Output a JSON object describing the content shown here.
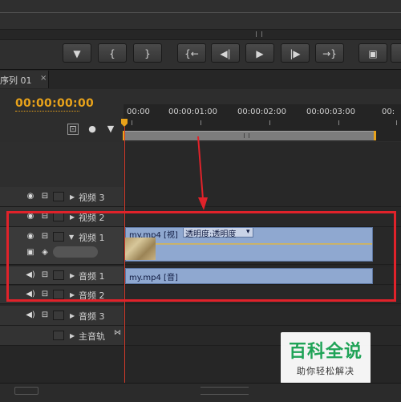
{
  "transport": {
    "buttons": [
      {
        "name": "marker-button",
        "glyph": "▼"
      },
      {
        "name": "mark-in-button",
        "glyph": "{"
      },
      {
        "name": "mark-out-button",
        "glyph": "}"
      },
      {
        "name": "go-to-in-button",
        "glyph": "{←"
      },
      {
        "name": "step-back-button",
        "glyph": "◀|"
      },
      {
        "name": "play-button",
        "glyph": "▶"
      },
      {
        "name": "step-forward-button",
        "glyph": "|▶"
      },
      {
        "name": "go-to-out-button",
        "glyph": "→}"
      },
      {
        "name": "lift-button",
        "glyph": "▣"
      }
    ]
  },
  "tab": {
    "label": "序列 01",
    "close": "×"
  },
  "header": {
    "timecode": "00:00:00:00"
  },
  "ruler": {
    "labels": [
      "00:00",
      "00:00:01:00",
      "00:00:02:00",
      "00:00:03:00",
      "00:"
    ]
  },
  "tracks": [
    {
      "name": "视频 3",
      "kind": "video"
    },
    {
      "name": "视频 2",
      "kind": "video"
    },
    {
      "name": "视频 1",
      "kind": "video"
    },
    {
      "name": "音频 1",
      "kind": "audio"
    },
    {
      "name": "音频 2",
      "kind": "audio"
    },
    {
      "name": "音频 3",
      "kind": "audio"
    },
    {
      "name": "主音轨",
      "kind": "master"
    }
  ],
  "clips": {
    "video": {
      "label": "my.mp4 [视]",
      "effect": "透明度:透明度",
      "dropdown_arrow": "▾"
    },
    "audio": {
      "label": "my.mp4 [音]"
    }
  },
  "watermark": {
    "title": "百科全说",
    "subtitle": "助你轻松解决"
  },
  "colors": {
    "timecode": "#e8a21a",
    "clip": "#8fa8d0",
    "annotation": "#e0222a",
    "watermark": "#1fa357"
  }
}
